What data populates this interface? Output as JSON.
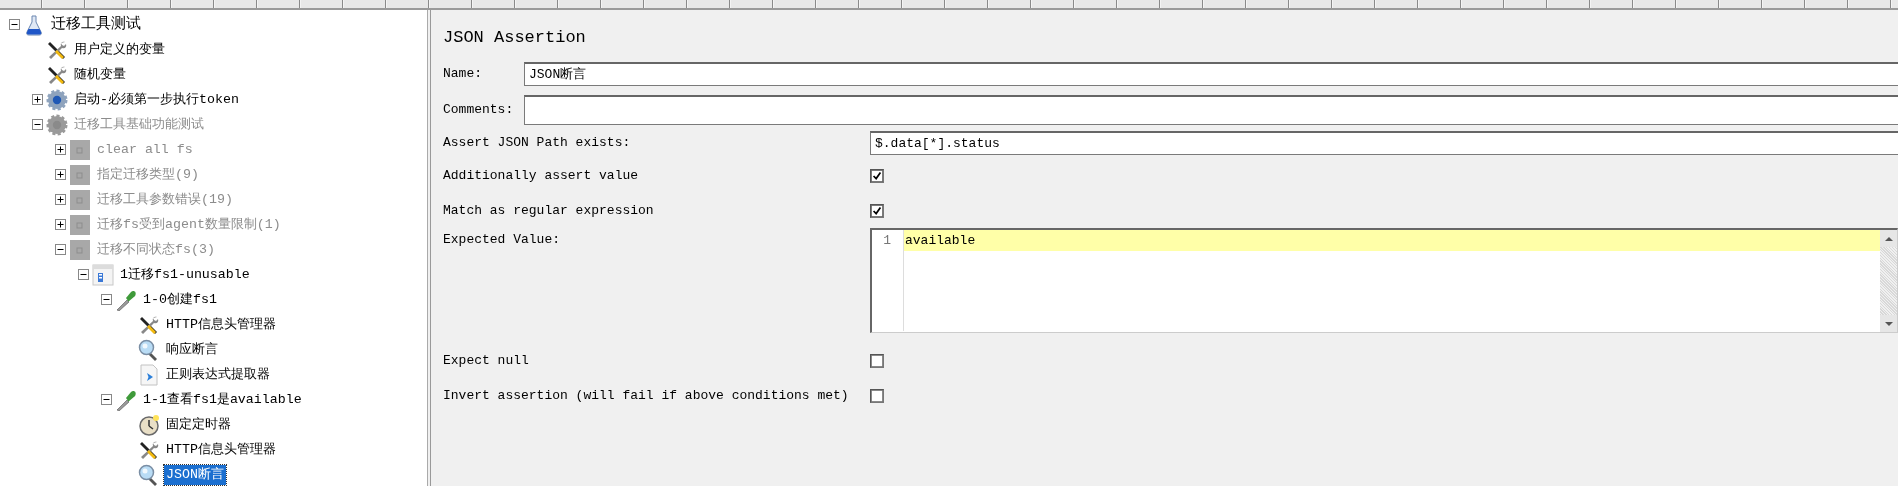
{
  "tree": [
    {
      "label": "迁移工具测试",
      "kind": "test-plan",
      "expanded": true,
      "disabled": false,
      "selected": false,
      "children": [
        {
          "label": "用户定义的变量",
          "kind": "config",
          "disabled": false,
          "selected": false
        },
        {
          "label": "随机变量",
          "kind": "config",
          "disabled": false,
          "selected": false
        },
        {
          "label": "启动-必须第一步执行token",
          "kind": "gear",
          "expanded": false,
          "disabled": false,
          "selected": false
        },
        {
          "label": "迁移工具基础功能测试",
          "kind": "gear",
          "expanded": true,
          "disabled": true,
          "selected": false,
          "children": [
            {
              "label": "clear all fs",
              "kind": "controller",
              "expanded": false,
              "disabled": true,
              "selected": false
            },
            {
              "label": "指定迁移类型(9)",
              "kind": "controller",
              "expanded": false,
              "disabled": true,
              "selected": false
            },
            {
              "label": "迁移工具参数错误(19)",
              "kind": "controller",
              "expanded": false,
              "disabled": true,
              "selected": false
            },
            {
              "label": "迁移fs受到agent数量限制(1)",
              "kind": "controller",
              "expanded": false,
              "disabled": true,
              "selected": false
            },
            {
              "label": "迁移不同状态fs(3)",
              "kind": "controller",
              "expanded": true,
              "disabled": true,
              "selected": false,
              "children": [
                {
                  "label": "1迁移fs1-unusable",
                  "kind": "transaction",
                  "expanded": true,
                  "disabled": false,
                  "selected": false,
                  "children": [
                    {
                      "label": "1-0创建fs1",
                      "kind": "sampler",
                      "expanded": true,
                      "disabled": false,
                      "selected": false,
                      "children": [
                        {
                          "label": "HTTP信息头管理器",
                          "kind": "config",
                          "disabled": false,
                          "selected": false
                        },
                        {
                          "label": "响应断言",
                          "kind": "assertion",
                          "disabled": false,
                          "selected": false
                        },
                        {
                          "label": "正则表达式提取器",
                          "kind": "extractor",
                          "disabled": false,
                          "selected": false
                        }
                      ]
                    },
                    {
                      "label": "1-1查看fs1是available",
                      "kind": "sampler",
                      "expanded": true,
                      "disabled": false,
                      "selected": false,
                      "children": [
                        {
                          "label": "固定定时器",
                          "kind": "timer",
                          "disabled": false,
                          "selected": false
                        },
                        {
                          "label": "HTTP信息头管理器",
                          "kind": "config",
                          "disabled": false,
                          "selected": false
                        },
                        {
                          "label": "JSON断言",
                          "kind": "assertion",
                          "disabled": false,
                          "selected": true
                        }
                      ]
                    }
                  ]
                }
              ]
            }
          ]
        }
      ]
    }
  ],
  "panel": {
    "title": "JSON Assertion",
    "rows": [
      {
        "kind": "header-field",
        "label": "Name:",
        "value": "JSON断言"
      },
      {
        "kind": "header-field",
        "label": "Comments:"
      },
      {
        "kind": "field",
        "label": "Assert JSON Path exists:",
        "value": "$.data[*].status"
      },
      {
        "kind": "checkbox",
        "label": "Additionally assert value",
        "checked": true
      },
      {
        "kind": "checkbox",
        "label": "Match as regular expression",
        "checked": true
      },
      {
        "kind": "editor",
        "label": "Expected Value:",
        "lines": [
          {
            "number": "1",
            "text": "available",
            "highlighted": true
          }
        ]
      },
      {
        "kind": "checkbox",
        "label": "Expect null",
        "checked": false
      },
      {
        "kind": "checkbox",
        "label": "Invert assertion (will fail if above conditions met)",
        "checked": false
      }
    ]
  }
}
